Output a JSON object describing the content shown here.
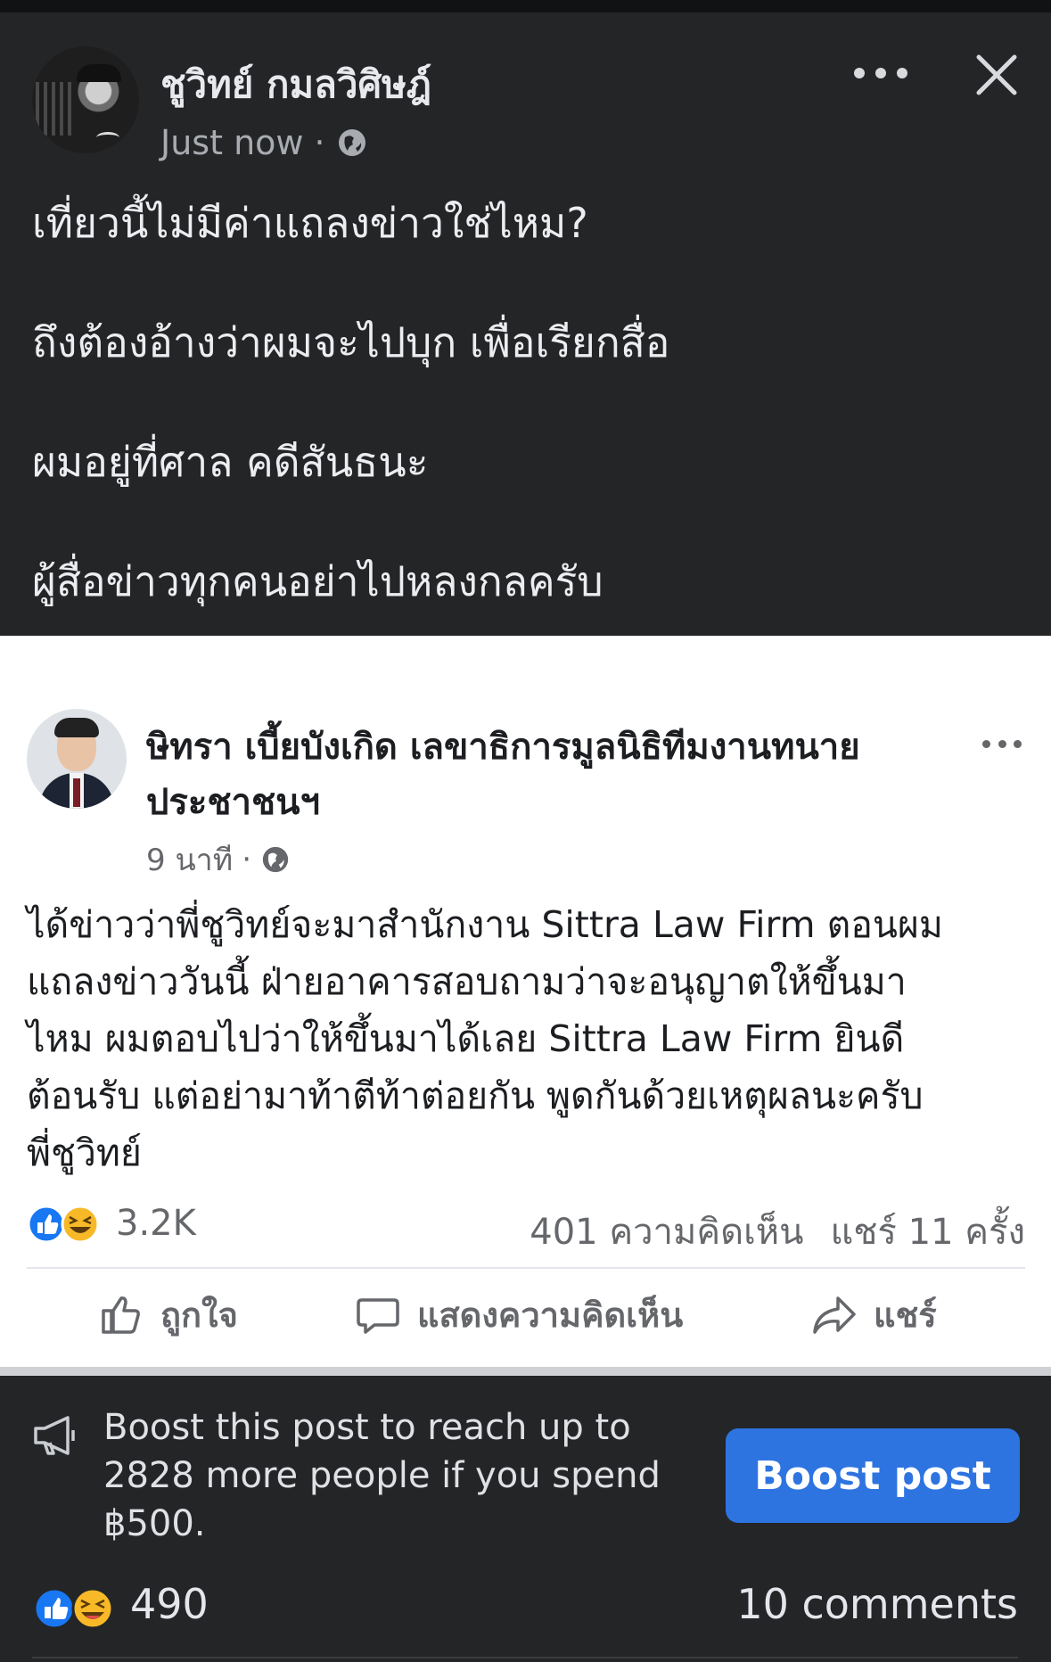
{
  "post": {
    "author": "ชูวิทย์ กมลวิศิษฎ์",
    "timestamp": "Just now",
    "separator": "·",
    "caption_lines": [
      "เที่ยวนี้ไม่มีค่าแถลงข่าวใช่ไหม?",
      "ถึงต้องอ้างว่าผมจะไปบุก เพื่อเรียกสื่อ",
      "ผมอยู่ที่ศาล คดีสันธนะ",
      "ผู้สื่อข่าวทุกคนอย่าไปหลงกลครับ"
    ]
  },
  "shared": {
    "author_line1": "ษิทรา เบี้ยบังเกิด เลขาธิการมูลนิธิทีมงานทนาย",
    "author_line2": "ประชาชนฯ",
    "timestamp": "9 นาที",
    "separator": "·",
    "body_lines": [
      "ได้ข่าวว่าพี่ชูวิทย์จะมาสำนักงาน Sittra Law Firm ตอนผม",
      "แถลงข่าววันนี้ ฝ่ายอาคารสอบถามว่าจะอนุญาตให้ขึ้นมา",
      "ไหม ผมตอบไปว่าให้ขึ้นมาได้เลย Sittra Law Firm ยินดี",
      "ต้อนรับ แต่อย่ามาท้าตีท้าต่อยกัน พูดกันด้วยเหตุผลนะครับ",
      "พี่ชูวิทย์"
    ],
    "reaction_count": "3.2K",
    "comments_text": "401 ความคิดเห็น",
    "shares_text": "แชร์ 11 ครั้ง",
    "actions": {
      "like": "ถูกใจ",
      "comment": "แสดงความคิดเห็น",
      "share": "แชร์"
    }
  },
  "boost": {
    "lines": [
      "Boost this post to reach up to",
      "2828 more people if you spend",
      "฿500."
    ],
    "button_label": "Boost post"
  },
  "footer": {
    "reaction_count": "490",
    "comments": "10 comments"
  },
  "icons": {
    "like": "like-reaction-icon",
    "haha": "haha-reaction-icon",
    "globe": "globe-icon",
    "more": "more-options-icon",
    "close": "close-icon",
    "megaphone": "megaphone-icon"
  },
  "colors": {
    "background": "#242527",
    "card": "#ffffff",
    "accent_blue": "#2d74e1",
    "meta_gray": "#a8abb0"
  }
}
